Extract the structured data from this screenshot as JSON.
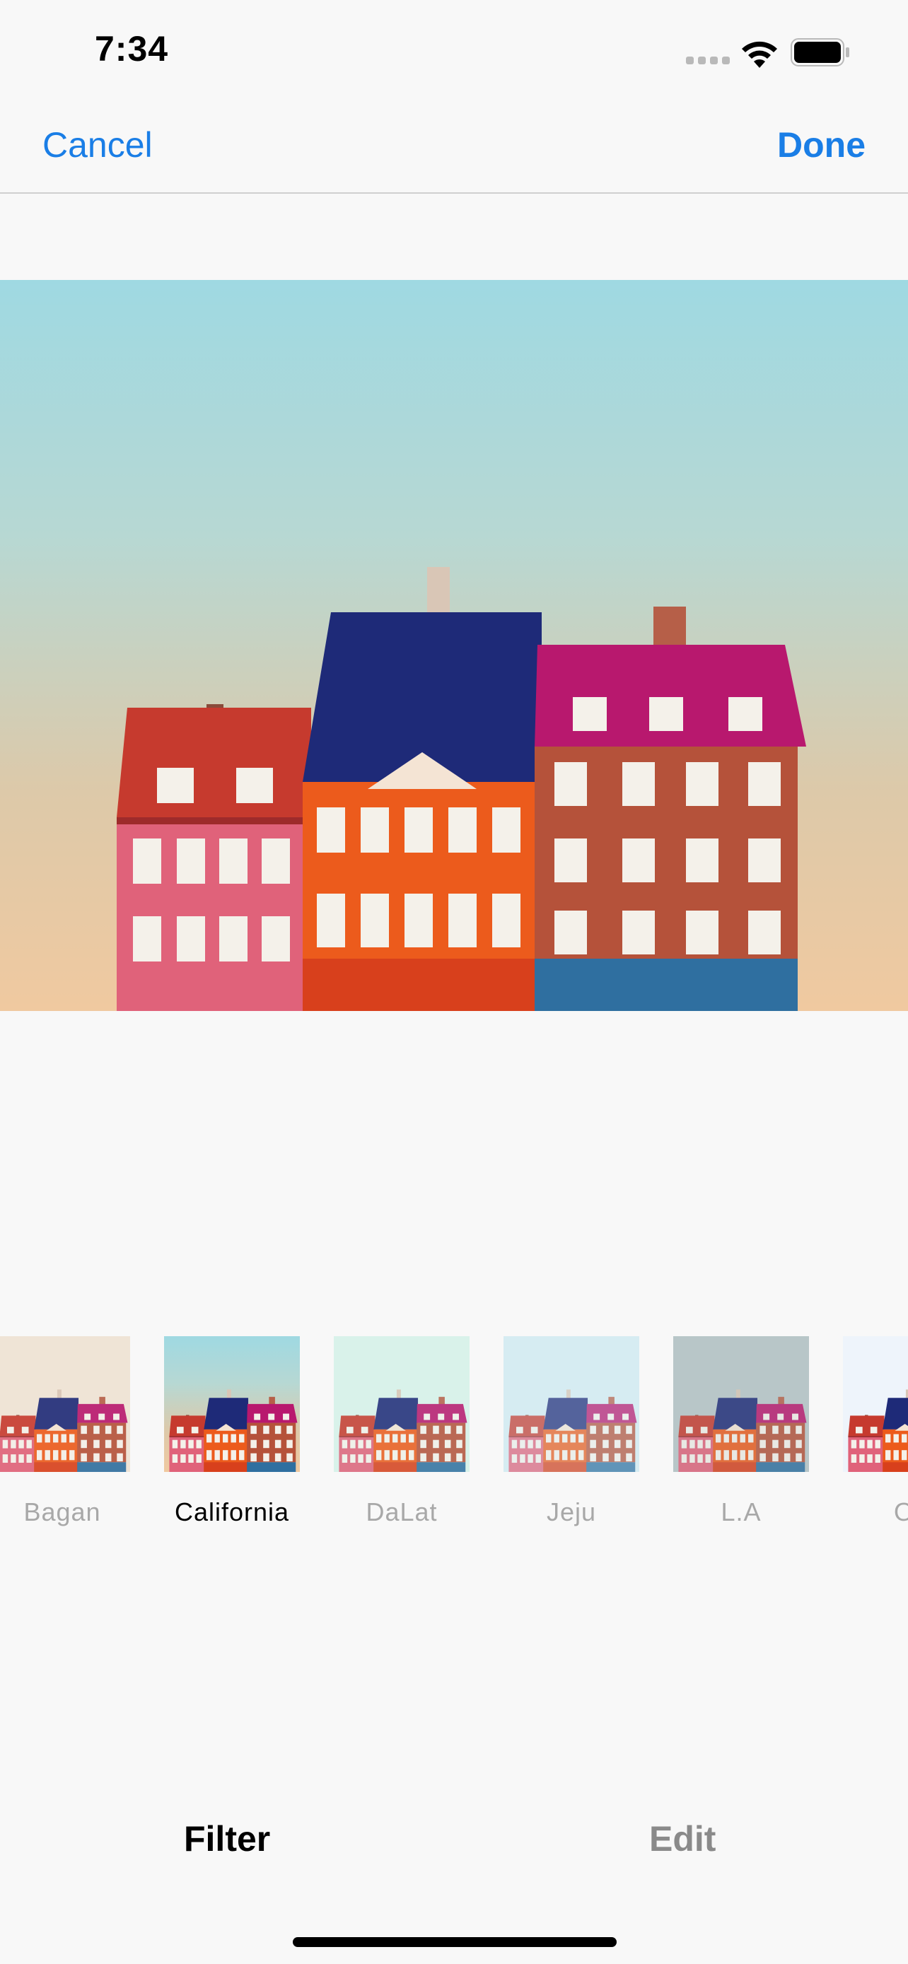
{
  "status_bar": {
    "time": "7:34",
    "signal_icon": "cellular-signal-icon",
    "wifi_icon": "wifi-icon",
    "battery_icon": "battery-icon"
  },
  "nav": {
    "cancel_label": "Cancel",
    "done_label": "Done",
    "accent_color": "#1a7ee6"
  },
  "filters": {
    "selected": "California",
    "items": [
      {
        "label": "Bagan"
      },
      {
        "label": "California"
      },
      {
        "label": "DaLat"
      },
      {
        "label": "Jeju"
      },
      {
        "label": "L.A"
      },
      {
        "label": "Os"
      }
    ]
  },
  "tabs": {
    "filter_label": "Filter",
    "edit_label": "Edit",
    "active": "Filter"
  }
}
